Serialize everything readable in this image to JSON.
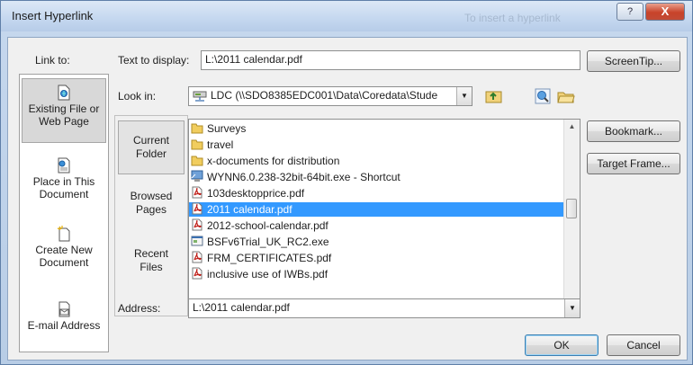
{
  "window": {
    "title": "Insert Hyperlink",
    "background_text": "To insert a hyperlink",
    "help_label": "?",
    "close_label": "X"
  },
  "link_to": {
    "label": "Link to:",
    "items": [
      {
        "label_line1": "Existing File or",
        "label_line2": "Web Page",
        "icon": "existing-file-icon",
        "selected": true
      },
      {
        "label_line1": "Place in This",
        "label_line2": "Document",
        "icon": "place-in-document-icon",
        "selected": false
      },
      {
        "label_line1": "Create New",
        "label_line2": "Document",
        "icon": "new-document-icon",
        "selected": false
      },
      {
        "label_line1": "E-mail Address",
        "label_line2": "",
        "icon": "email-icon",
        "selected": false
      }
    ]
  },
  "text_to_display": {
    "label": "Text to display:",
    "value": "L:\\2011 calendar.pdf"
  },
  "screentip_button": "ScreenTip...",
  "look_in": {
    "label": "Look in:",
    "value": "LDC (\\\\SDO8385EDC001\\Data\\Coredata\\Stude"
  },
  "nav": {
    "current_folder_1": "Current",
    "current_folder_2": "Folder",
    "browsed_pages_1": "Browsed",
    "browsed_pages_2": "Pages",
    "recent_files_1": "Recent",
    "recent_files_2": "Files"
  },
  "files": [
    {
      "name": "Surveys",
      "type": "folder"
    },
    {
      "name": "travel",
      "type": "folder"
    },
    {
      "name": "x-documents for distribution",
      "type": "folder"
    },
    {
      "name": "WYNN6.0.238-32bit-64bit.exe - Shortcut",
      "type": "shortcut"
    },
    {
      "name": "103desktopprice.pdf",
      "type": "pdf"
    },
    {
      "name": "2011 calendar.pdf",
      "type": "pdf",
      "selected": true
    },
    {
      "name": "2012-school-calendar.pdf",
      "type": "pdf"
    },
    {
      "name": "BSFv6Trial_UK_RC2.exe",
      "type": "exe"
    },
    {
      "name": "FRM_CERTIFICATES.pdf",
      "type": "pdf"
    },
    {
      "name": "inclusive use of IWBs.pdf",
      "type": "pdf"
    }
  ],
  "side_buttons": {
    "bookmark": "Bookmark...",
    "target_frame": "Target Frame..."
  },
  "address": {
    "label": "Address:",
    "value": "L:\\2011 calendar.pdf"
  },
  "ok_button": "OK",
  "cancel_button": "Cancel",
  "colors": {
    "selection": "#3399ff",
    "title_bar": "#c4d7ef",
    "close_button": "#c8432a"
  }
}
